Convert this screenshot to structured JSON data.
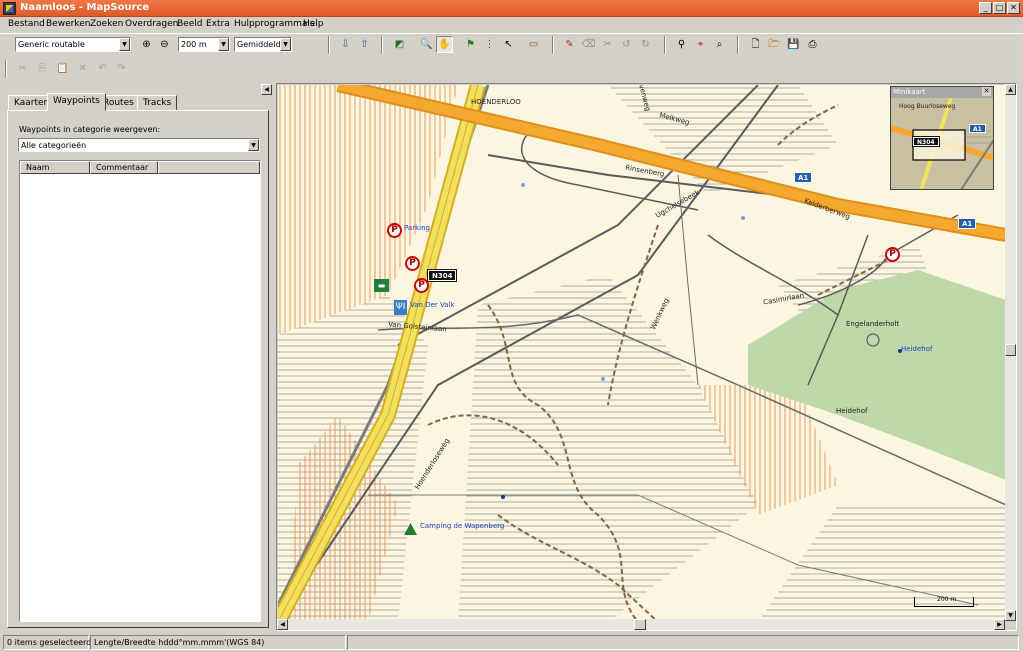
{
  "window": {
    "title": "Naamloos - MapSource"
  },
  "menu": [
    "Bestand",
    "Bewerken",
    "Zoeken",
    "Overdragen",
    "Beeld",
    "Extra",
    "Hulpprogramma's",
    "Help"
  ],
  "toolbar": {
    "product": "Generic routable",
    "zoom": "200 m",
    "detail": "Gemiddeld"
  },
  "tabs": [
    "Kaarten",
    "Waypoints",
    "Routes",
    "Tracks"
  ],
  "waypoints": {
    "category_label": "Waypoints in categorie weergeven:",
    "category_value": "Alle categorieën",
    "columns": [
      "Naam",
      "Commentaar"
    ]
  },
  "map": {
    "roads": [
      "Heuvenweg",
      "Melkweg",
      "Rinsenberg",
      "Ugchelsebeek",
      "Kelderberweg",
      "Casimirlaan",
      "Engelanderholt",
      "Heidehof",
      "Van Golsteinlaan",
      "Hoenderloseweg",
      "Wenkweg"
    ],
    "places": [
      "HOENDERLOO"
    ],
    "shields": [
      "A1",
      "N304"
    ],
    "waypoints": [
      "Parking",
      "Van Der Valk",
      "Heidehof",
      "Camping de Wapenberg"
    ],
    "scale": "200 m",
    "minimap_title": "Minikaart",
    "minimap_label": "Hoog Buurloseweg"
  },
  "status": {
    "selected": "0 items geselecteerd",
    "coords": "Lengte/Breedte hddd°mm.mmm'(WGS 84)"
  }
}
